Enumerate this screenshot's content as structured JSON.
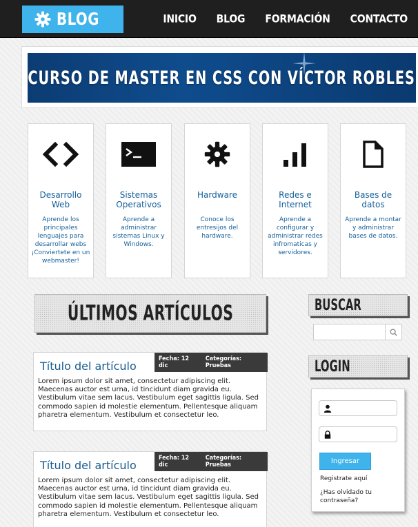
{
  "header": {
    "logo_text": "BLOG",
    "nav": [
      "INICIO",
      "BLOG",
      "FORMACIÓN",
      "CONTACTO"
    ]
  },
  "banner": {
    "title": "CURSO DE MASTER EN CSS CON VÍCTOR ROBLES"
  },
  "features": [
    {
      "icon": "code-icon",
      "title": "Desarrollo Web",
      "text": "Aprende los principales lenguajes para desarrollar webs ¡Conviertete en un webmaster!"
    },
    {
      "icon": "terminal-icon",
      "title": "Sistemas Operativos",
      "text": "Aprende a administrar sistemas Linux y Windows."
    },
    {
      "icon": "gear-icon",
      "title": "Hardware",
      "text": "Conoce los entresijos del hardware."
    },
    {
      "icon": "signal-bars-icon",
      "title": "Redes e Internet",
      "text": "Aprende a configurar y administrar redes infromaticas y servidores."
    },
    {
      "icon": "document-icon",
      "title": "Bases de datos",
      "text": "Aprende a montar y administrar bases de datos."
    }
  ],
  "articles_heading": "ÚLTIMOS ARTÍCULOS",
  "articles": [
    {
      "title": "Título del artículo",
      "date": "Fecha: 12 dic",
      "categories": "Categorías: Pruebas",
      "body": "Lorem ipsum dolor sit amet, consectetur adipiscing elit. Maecenas auctor est urna, id tincidunt diam gravida eu. Vestibulum vitae sem lacus. Vestibulum eget sagittis ligula. Sed commodo sapien id molestie elementum. Pellentesque aliquam pharetra elementum. Vestibulum et consectetur leo."
    },
    {
      "title": "Título del artículo",
      "date": "Fecha: 12 dic",
      "categories": "Categorías: Pruebas",
      "body": "Lorem ipsum dolor sit amet, consectetur adipiscing elit. Maecenas auctor est urna, id tincidunt diam gravida eu. Vestibulum vitae sem lacus. Vestibulum eget sagittis ligula. Sed commodo sapien id molestie elementum. Pellentesque aliquam pharetra elementum. Vestibulum et consectetur leo."
    }
  ],
  "sidebar": {
    "search_heading": "BUSCAR",
    "search_value": "",
    "login_heading": "LOGIN",
    "username_value": "",
    "password_value": "",
    "login_button": "Ingresar",
    "register_link": "Registrate aquí",
    "forgot_link": "¿Has olvidado tu contraseña?"
  },
  "colors": {
    "accent": "#3fb3ec",
    "header_bg": "#1f1f1f",
    "link_blue": "#135f99",
    "banner_blue": "#0f4c8d"
  }
}
